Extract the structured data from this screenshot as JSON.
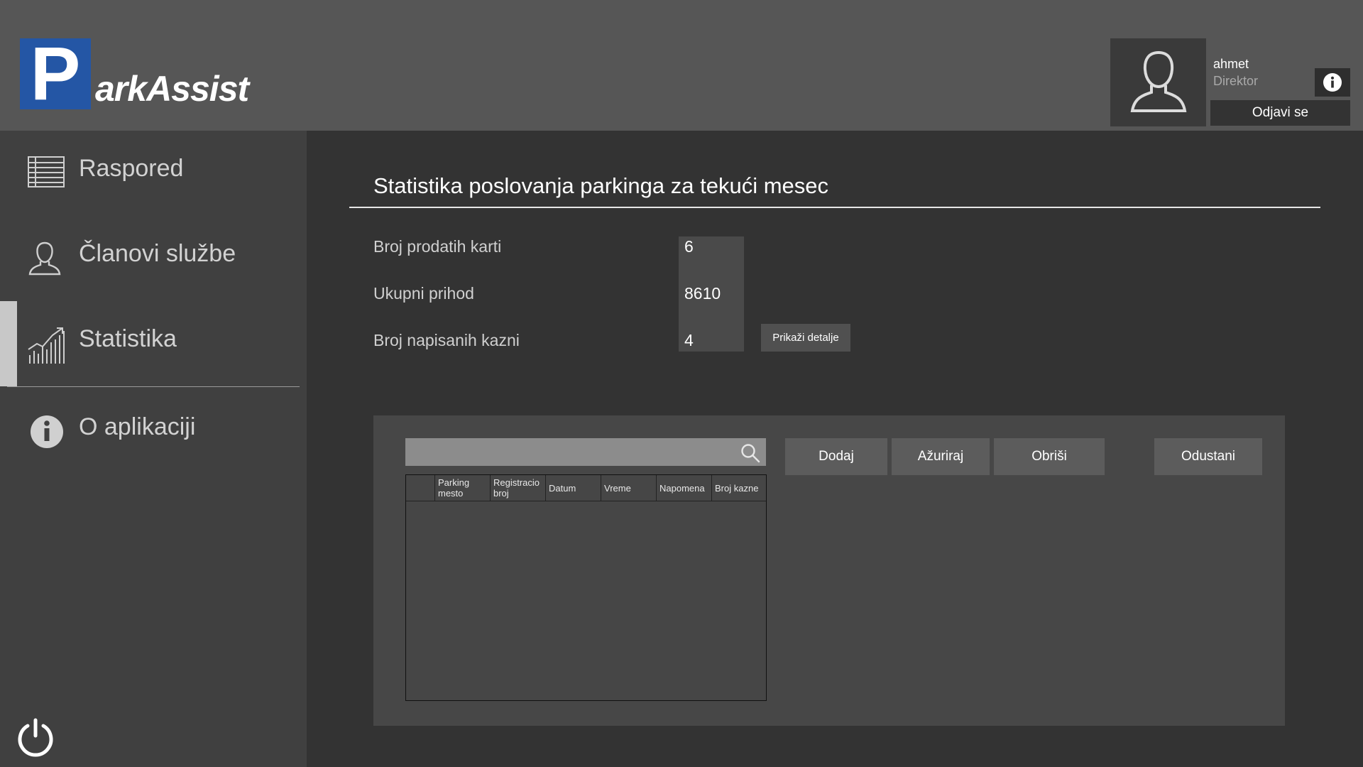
{
  "app": {
    "logo_letter": "P",
    "logo_text": "arkAssist"
  },
  "user": {
    "name": "ahmet",
    "role": "Direktor",
    "logout_label": "Odjavi se"
  },
  "sidebar": {
    "items": [
      {
        "label": "Raspored",
        "icon": "schedule-icon"
      },
      {
        "label": "Članovi službe",
        "icon": "person-icon"
      },
      {
        "label": "Statistika",
        "icon": "chart-icon"
      },
      {
        "label": "O aplikaciji",
        "icon": "info-icon"
      }
    ],
    "active": "Statistika"
  },
  "main": {
    "title": "Statistika poslovanja parkinga za tekući mesec",
    "stats": [
      {
        "label": "Broj prodatih karti",
        "value": "6"
      },
      {
        "label": "Ukupni prihod",
        "value": "8610"
      },
      {
        "label": "Broj napisanih kazni",
        "value": "4"
      }
    ],
    "details_button": "Prikaži detalje",
    "search": {
      "value": "",
      "placeholder": ""
    },
    "buttons": {
      "add": "Dodaj",
      "update": "Ažuriraj",
      "delete": "Obriši",
      "cancel": "Odustani"
    },
    "table": {
      "columns": [
        "",
        "Parking mesto",
        "Registracio broj",
        "Datum",
        "Vreme",
        "Napomena",
        "Broj kazne"
      ],
      "rows": []
    }
  },
  "colors": {
    "header": "#565656",
    "sidebar": "#404040",
    "logo": "#2456a5",
    "background": "#333333"
  }
}
